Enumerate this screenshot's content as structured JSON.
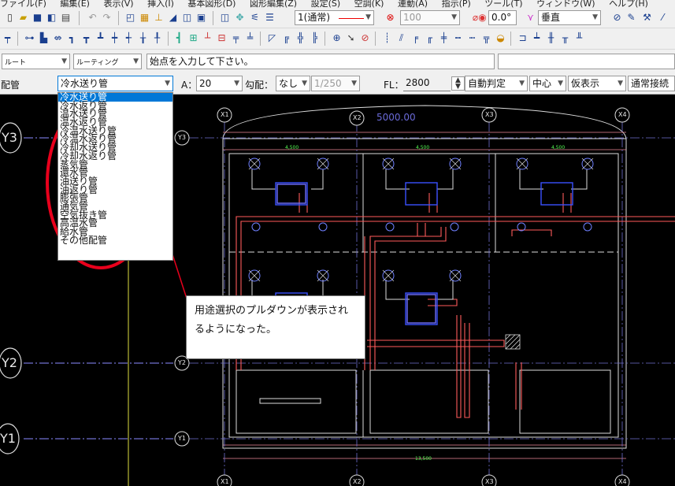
{
  "menu": [
    "ファイル(F)",
    "編集(E)",
    "表示(V)",
    "挿入(I)",
    "基本図形(D)",
    "図形編集(Z)",
    "設定(S)",
    "空調(K)",
    "連動(A)",
    "指示(P)",
    "ツール(T)",
    "ウィンドウ(W)",
    "ヘルプ(H)"
  ],
  "toolbar1": {
    "layer": "1(通常)",
    "transparency": "100",
    "angle": "0.0°",
    "vertical": "垂直"
  },
  "toolbar3": {
    "route": "ルート",
    "routing": "ルーティング",
    "prompt": "始点を入力して下さい。"
  },
  "toolbar4": {
    "category": "配管",
    "usage_selected": "冷水送り管",
    "a_label": "A：",
    "a_value": "20",
    "slope_label": "勾配：",
    "slope_value": "なし",
    "slope_ratio": "1/250",
    "fl_label": "FL：",
    "fl_value": "2800",
    "auto_judge": "自動判定",
    "center": "中心",
    "display": "仮表示",
    "connection": "通常接続"
  },
  "dropdown_options": [
    "冷水送り管",
    "冷水返り管",
    "温水送り管",
    "温水返り管",
    "冷温水送り管",
    "冷温水返り管",
    "冷却水送り管",
    "冷却水返り管",
    "蒸気管",
    "還水管",
    "油送り管",
    "油返り管",
    "膨張管",
    "通気管",
    "空気抜き管",
    "高温水管",
    "給水管",
    "その他配管"
  ],
  "drawing": {
    "grid_rows": [
      "Y3",
      "Y2",
      "Y1"
    ],
    "grid_cols": [
      "X1",
      "X2",
      "X3",
      "X4"
    ],
    "dim_top": "5000.00",
    "span_labels": [
      "4,500",
      "4,500",
      "4,500"
    ],
    "total_width": "13,500"
  },
  "callout_text": "用途選択のプルダウンが表示されるようになった。",
  "colors": {
    "canvas": "#000000",
    "pipe": "#ff4444",
    "highlight_ellipse": "#e8001c",
    "selection": "#0078d7"
  }
}
